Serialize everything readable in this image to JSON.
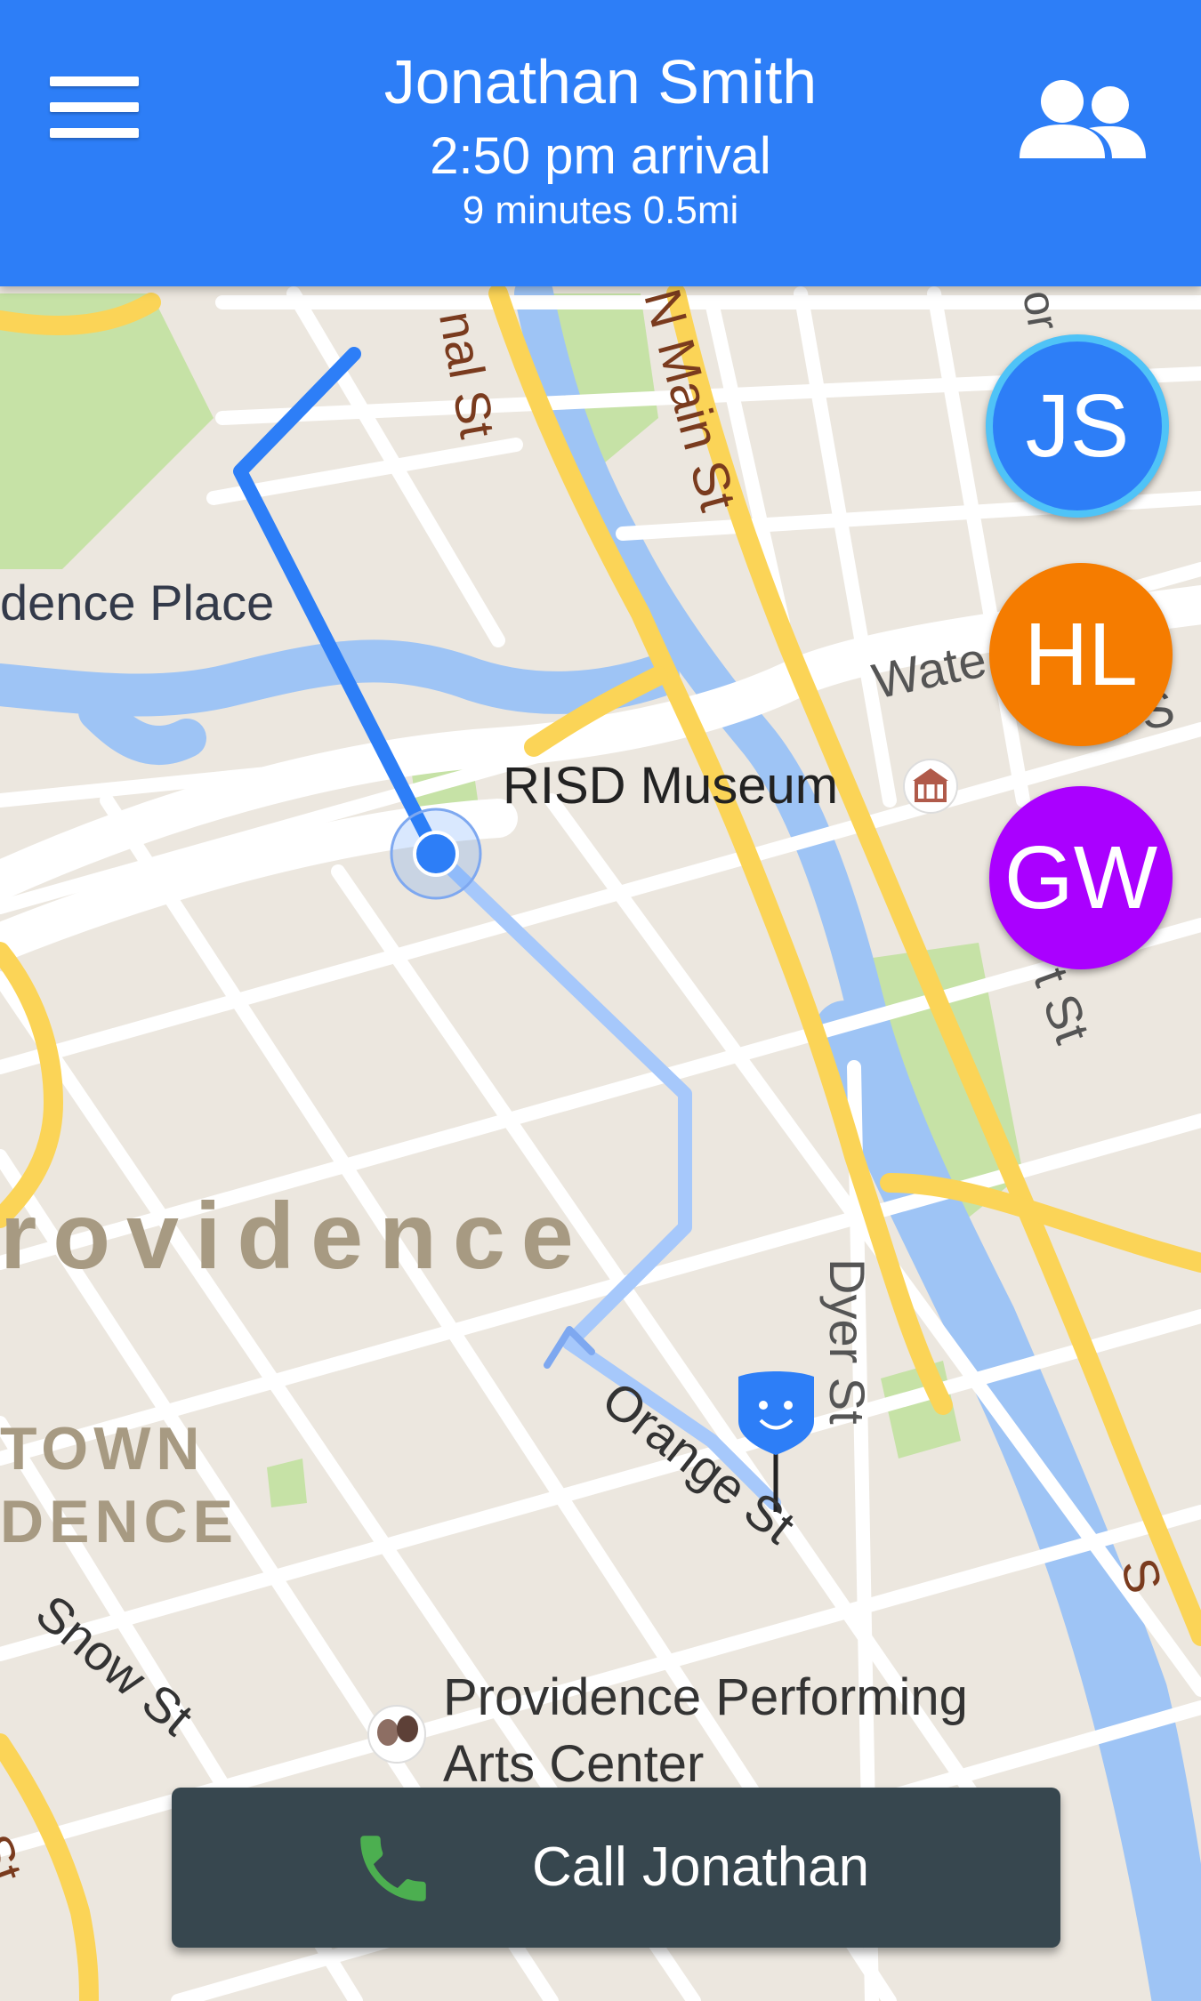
{
  "header": {
    "name": "Jonathan Smith",
    "arrival": "2:50 pm arrival",
    "eta": "9 minutes 0.5mi",
    "menu_icon": "hamburger-menu-icon",
    "contacts_icon": "people-icon"
  },
  "contacts": [
    {
      "initials": "JS",
      "color": "#2d7ef7",
      "ring": "#4fc3f7"
    },
    {
      "initials": "HL",
      "color": "#f57c00"
    },
    {
      "initials": "GW",
      "color": "#aa00ff"
    }
  ],
  "map": {
    "labels": {
      "st_partial_top": "nal St",
      "n_main_st": "N Main St",
      "providence_place": "dence Place",
      "water_st": "Wate",
      "s_partial_right": "n S",
      "risd_museum": "RISD Museum",
      "south_st_partial": "t St",
      "providence": "rovidence",
      "dyer_st": "Dyer St",
      "downtown_1": "TOWN",
      "downtown_2": "DENCE",
      "orange_st": "Orange St",
      "snow_st": "Snow St",
      "ppac_1": "Providence Performing",
      "ppac_2": "Arts Center",
      "st_partial_bottom": "e St",
      "st_partial_bottom_right": "S",
      "st_partial_top_right": "or"
    },
    "colors": {
      "route_traveled": "#2d7ef7",
      "route_remaining": "#a6c8fb",
      "major_road": "#fbd457",
      "water": "#9ec4f5"
    },
    "destination_icon": "smiley-shield-pin-icon",
    "museum_icon": "museum-icon",
    "theater_icon": "theater-masks-icon"
  },
  "call_button": {
    "label": "Call Jonathan",
    "icon": "phone-icon",
    "icon_color": "#4caf50"
  }
}
